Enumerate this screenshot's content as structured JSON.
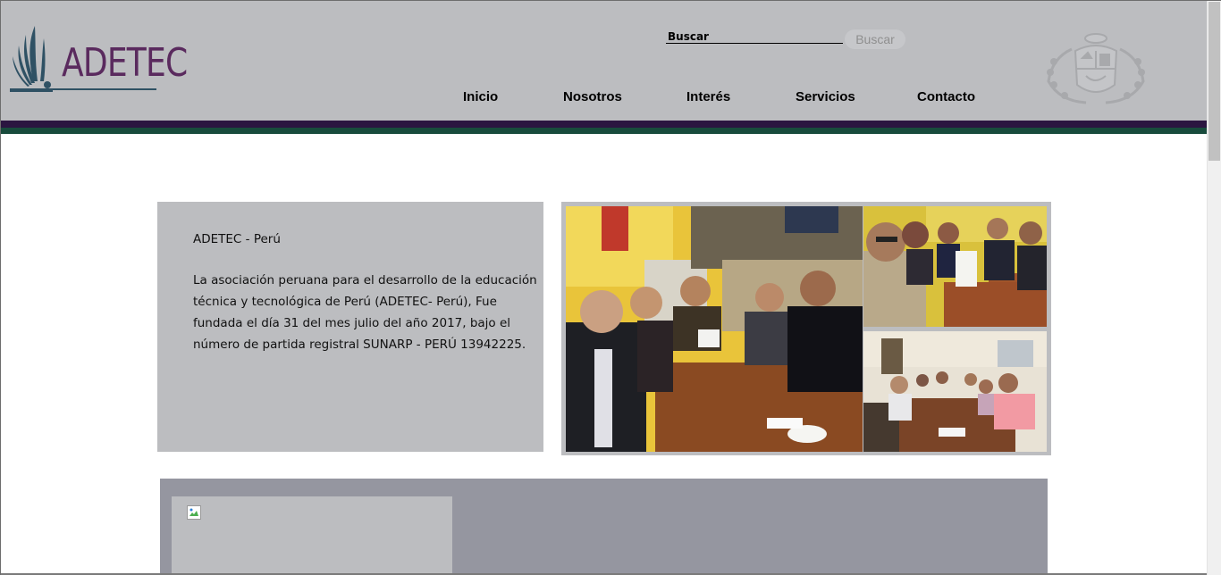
{
  "brand": {
    "logo_text": "ADETEC"
  },
  "search": {
    "label": "Buscar",
    "button_label": "Buscar"
  },
  "nav": {
    "items": [
      {
        "label": "Inicio"
      },
      {
        "label": "Nosotros"
      },
      {
        "label": "Interés"
      },
      {
        "label": "Servicios"
      },
      {
        "label": "Contacto"
      }
    ]
  },
  "about": {
    "title": "ADETEC - Perú",
    "body": "La asociación peruana para el desarrollo de la educación técnica y tecnológica de Perú (ADETEC- Perú), Fue fundada el día 31 del mes julio del año 2017, bajo el número de partida registral SUNARP - PERÚ 13942225."
  },
  "colors": {
    "header_bg": "#bcbdc0",
    "stripe_purple": "#2b1540",
    "stripe_green": "#184b3c",
    "logo_purple": "#5a2a5e",
    "band_bg": "#9596a0"
  },
  "icons": {
    "logo_mark": "adetec-fan-logo-icon",
    "emblem": "peru-coat-of-arms-icon",
    "broken_image": "broken-image-icon"
  }
}
